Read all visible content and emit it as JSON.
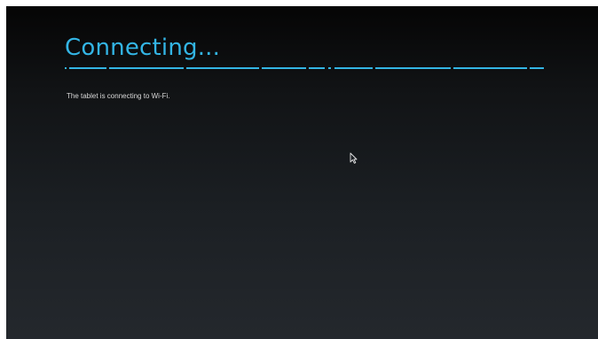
{
  "setup": {
    "title": "Connecting...",
    "message": "The tablet is connecting to Wi-Fi.",
    "accent_color": "#33b5e5"
  },
  "pointer": {
    "icon": "mouse-pointer-icon"
  }
}
